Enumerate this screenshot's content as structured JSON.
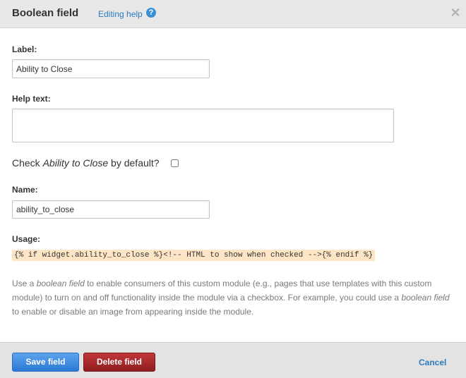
{
  "header": {
    "title": "Boolean field",
    "help_link": "Editing help",
    "help_icon": "?",
    "close_icon": "✕"
  },
  "form": {
    "label_heading": "Label:",
    "label_value": "Ability to Close",
    "help_text_heading": "Help text:",
    "help_text_value": "",
    "check_prefix": "Check ",
    "check_field_name": "Ability to Close",
    "check_suffix": " by default?",
    "check_default_checked": false,
    "name_heading": "Name:",
    "name_value": "ability_to_close",
    "usage_heading": "Usage:",
    "usage_code": "{% if widget.ability_to_close %}<!-- HTML to show when checked -->{% endif %}",
    "description": {
      "part1": "Use a ",
      "em1": "boolean field",
      "part2": " to enable consumers of this custom module (e.g., pages that use templates with this custom module) to turn on and off functionality inside the module via a checkbox. For example, you could use a ",
      "em2": "boolean field",
      "part3": " to enable or disable an image from appearing inside the module."
    }
  },
  "footer": {
    "save_label": "Save field",
    "delete_label": "Delete field",
    "cancel_label": "Cancel"
  },
  "colors": {
    "link": "#2a7ac0",
    "save_button": "#3b87dd",
    "delete_button": "#a82a2b",
    "code_highlight": "#fde5c6",
    "header_bg": "#e8e8e8",
    "footer_bg": "#e3e3e3"
  }
}
